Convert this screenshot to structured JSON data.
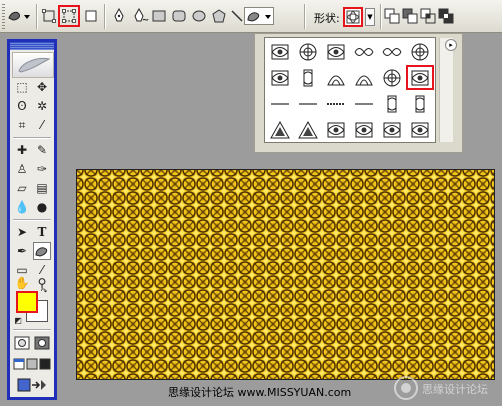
{
  "options_bar": {
    "shape_label": "形状:",
    "tools": [
      {
        "name": "preset-shape-tool-icon"
      },
      {
        "name": "shape-layers-mode-icon"
      },
      {
        "name": "paths-mode-icon",
        "highlighted": true
      },
      {
        "name": "fill-pixels-mode-icon"
      },
      {
        "name": "pen-tool-icon"
      },
      {
        "name": "freeform-pen-tool-icon"
      },
      {
        "name": "rectangle-tool-icon"
      },
      {
        "name": "rounded-rectangle-tool-icon"
      },
      {
        "name": "ellipse-tool-icon"
      },
      {
        "name": "polygon-tool-icon"
      },
      {
        "name": "line-tool-icon"
      },
      {
        "name": "custom-shape-tool-icon"
      }
    ],
    "combine_modes": [
      "add-icon",
      "subtract-icon",
      "intersect-icon",
      "exclude-icon"
    ]
  },
  "shape_palette": {
    "rows": 4,
    "cols": 6,
    "selected": {
      "row": 1,
      "col": 5
    },
    "menu_arrow": "▸"
  },
  "tools_panel": {
    "foreground_color": "#ffff00",
    "background_color": "#ffffff"
  },
  "canvas": {
    "pattern_colors": [
      "#c99a12",
      "#f5c81a",
      "#4a2e00",
      "#ffe860"
    ]
  },
  "footer": {
    "site_credit": "思缘设计论坛",
    "site_url": "www.MISSYUAN.com"
  },
  "watermark": {
    "text": "思缘设计论坛"
  },
  "colors": {
    "highlight": "#e8141b",
    "panel_border": "#1f2fb8"
  }
}
